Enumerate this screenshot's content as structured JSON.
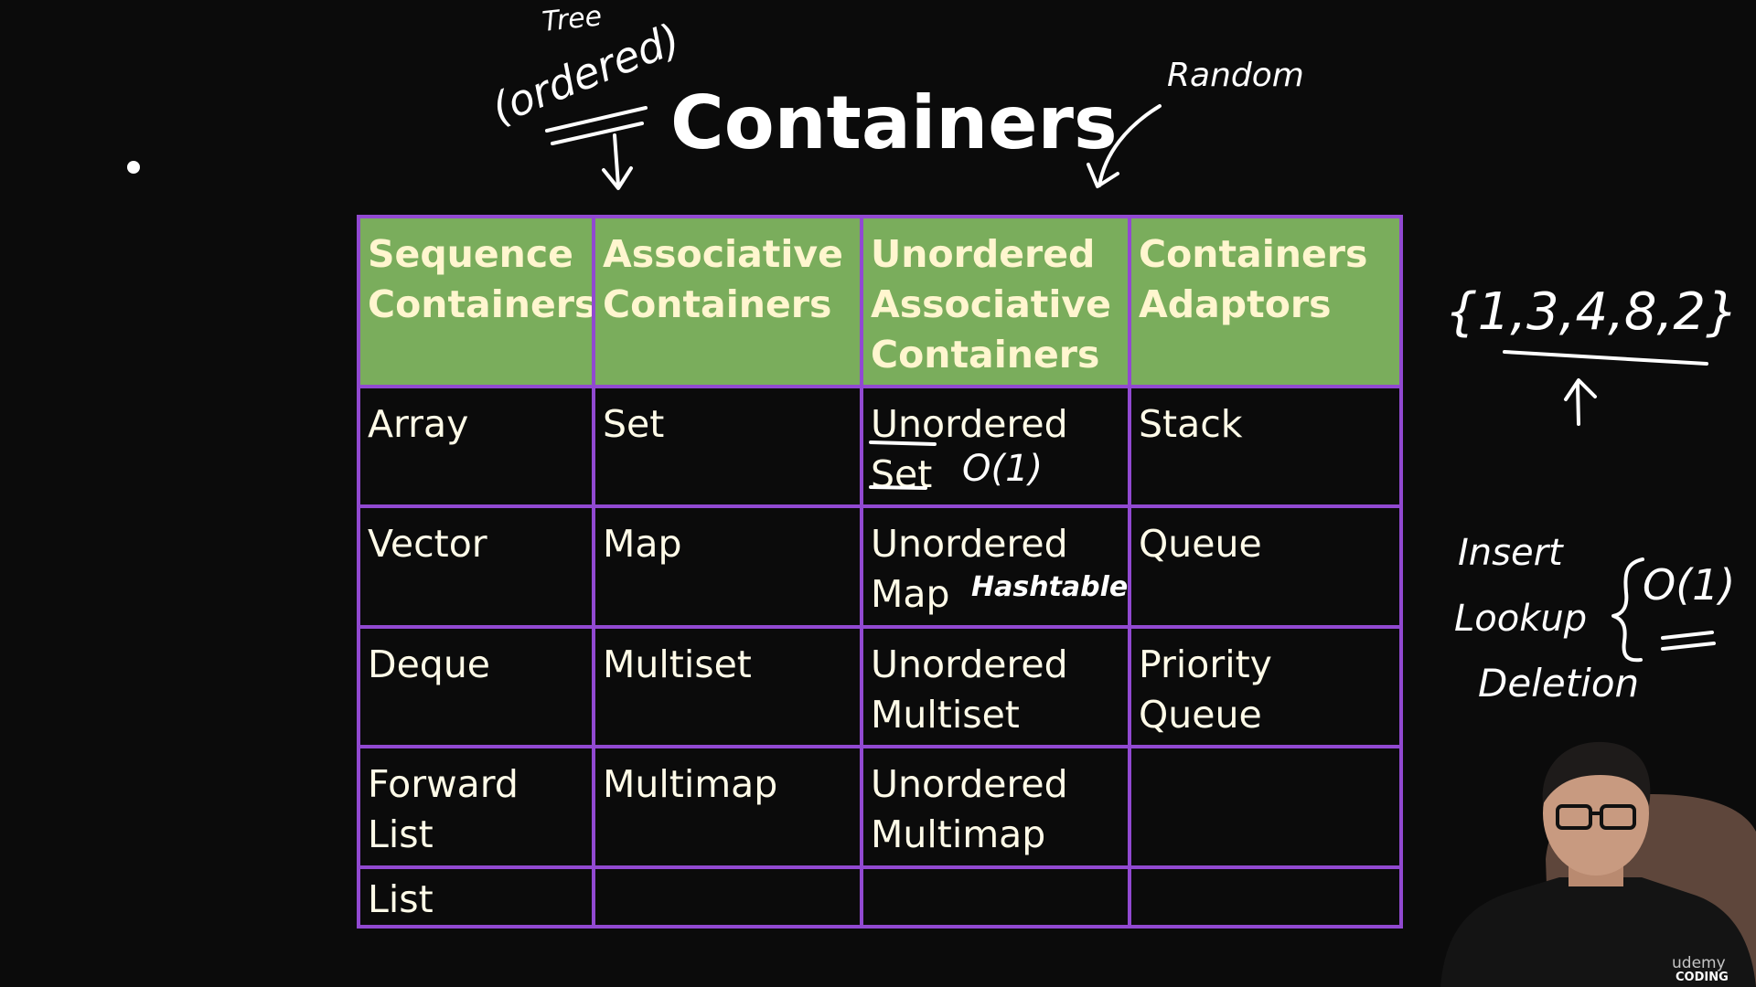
{
  "slide": {
    "title": "Containers"
  },
  "table": {
    "headers": [
      "Sequence Containers",
      "Associative Containers",
      "Unordered Associative Containers",
      "Containers Adaptors"
    ],
    "rows": [
      [
        "Array",
        "Set",
        "Unordered Set",
        "Stack"
      ],
      [
        "Vector",
        "Map",
        "Unordered Map",
        "Queue"
      ],
      [
        "Deque",
        "Multiset",
        "Unordered Multiset",
        "Priority Queue"
      ],
      [
        "Forward List",
        "Multimap",
        "Unordered Multimap",
        ""
      ],
      [
        "List",
        "",
        "",
        ""
      ]
    ]
  },
  "annotations": {
    "tree": "Tree",
    "ordered": "(ordered)",
    "random": "Random",
    "set_complexity": "O(1)",
    "hashtable": "Hashtable",
    "example_set": "{1,3,4,8,2}",
    "insert": "Insert",
    "lookup": "Lookup",
    "deletion": "Deletion",
    "ops_complexity": "O(1)"
  },
  "branding": {
    "line1": "udemy",
    "line2": "CODING"
  },
  "colors": {
    "header_bg": "#7aad5c",
    "header_text": "#fff6cf",
    "border": "#9149d1",
    "background": "#0b0b0b",
    "cell_text": "#fffbe8"
  }
}
